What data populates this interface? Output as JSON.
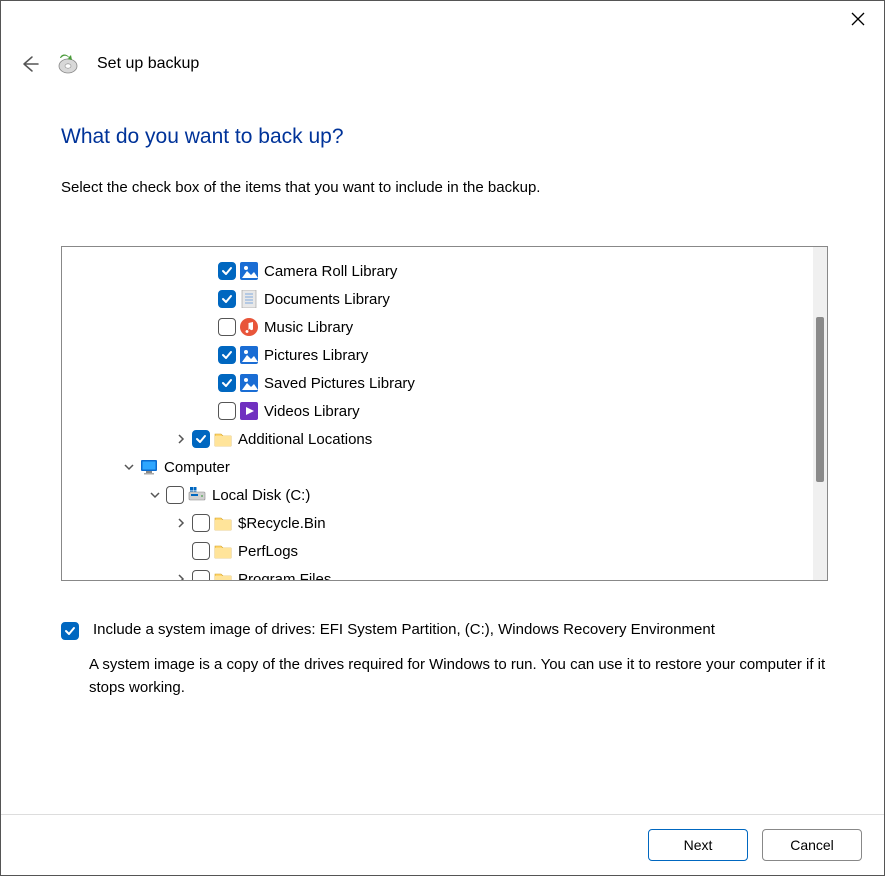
{
  "window": {
    "title": "Set up backup"
  },
  "page": {
    "heading": "What do you want to back up?",
    "instruction": "Select the check box of the items that you want to include in the backup."
  },
  "tree": {
    "items": [
      {
        "indent": 3,
        "expander": "none",
        "checked": true,
        "icon": "picture",
        "label": "Camera Roll Library"
      },
      {
        "indent": 3,
        "expander": "none",
        "checked": true,
        "icon": "document",
        "label": "Documents Library"
      },
      {
        "indent": 3,
        "expander": "none",
        "checked": false,
        "icon": "music",
        "label": "Music Library"
      },
      {
        "indent": 3,
        "expander": "none",
        "checked": true,
        "icon": "picture",
        "label": "Pictures Library"
      },
      {
        "indent": 3,
        "expander": "none",
        "checked": true,
        "icon": "picture",
        "label": "Saved Pictures Library"
      },
      {
        "indent": 3,
        "expander": "none",
        "checked": false,
        "icon": "video",
        "label": "Videos Library"
      },
      {
        "indent": 2,
        "expander": "closed",
        "checked": true,
        "icon": "folder",
        "label": "Additional Locations"
      },
      {
        "indent": 0,
        "expander": "open",
        "checked": null,
        "icon": "monitor",
        "label": "Computer"
      },
      {
        "indent": 1,
        "expander": "open",
        "checked": false,
        "icon": "drive",
        "label": "Local Disk (C:)"
      },
      {
        "indent": 2,
        "expander": "closed",
        "checked": false,
        "icon": "folder",
        "label": "$Recycle.Bin"
      },
      {
        "indent": 2,
        "expander": "none",
        "checked": false,
        "icon": "folder",
        "label": "PerfLogs"
      },
      {
        "indent": 2,
        "expander": "closed",
        "checked": false,
        "icon": "folder",
        "label": "Program Files"
      }
    ]
  },
  "systemImage": {
    "checked": true,
    "label": "Include a system image of drives: EFI System Partition, (C:), Windows Recovery Environment",
    "description": "A system image is a copy of the drives required for Windows to run. You can use it to restore your computer if it stops working."
  },
  "footer": {
    "next": "Next",
    "cancel": "Cancel"
  }
}
